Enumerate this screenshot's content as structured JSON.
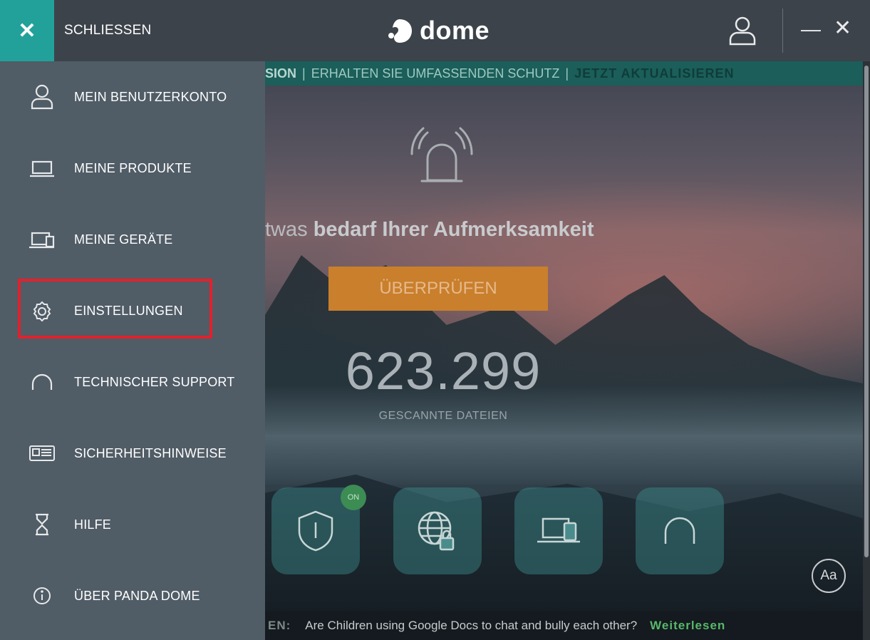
{
  "titlebar": {
    "close_label": "SCHLIESSEN",
    "logo_text": "dome"
  },
  "menu": {
    "items": [
      {
        "label": "MEIN BENUTZERKONTO",
        "icon": "user-icon"
      },
      {
        "label": "MEINE PRODUKTE",
        "icon": "laptop-icon"
      },
      {
        "label": "MEINE GERÄTE",
        "icon": "devices-icon"
      },
      {
        "label": "EINSTELLUNGEN",
        "icon": "gear-icon"
      },
      {
        "label": "TECHNISCHER SUPPORT",
        "icon": "headset-icon"
      },
      {
        "label": "SICHERHEITSHINWEISE",
        "icon": "news-icon"
      },
      {
        "label": "HILFE",
        "icon": "hourglass-icon"
      },
      {
        "label": "ÜBER PANDA DOME",
        "icon": "info-icon"
      }
    ]
  },
  "promo": {
    "part1": "SION",
    "part2": "ERHALTEN SIE UMFASSENDEN SCHUTZ",
    "cta": "JETZT AKTUALISIEREN"
  },
  "main": {
    "alert_prefix": "twas",
    "alert_bold": "bedarf Ihrer Aufmerksamkeit",
    "check_button": "ÜBERPRÜFEN",
    "scanned_count": "623.299",
    "scanned_label": "GESCANNTE DATEIEN",
    "on_badge": "ON",
    "aa_label": "Aa"
  },
  "news": {
    "label": "EN:",
    "headline": "Are Children using Google Docs to chat and bully each other?",
    "more": "Weiterlesen"
  },
  "colors": {
    "accent_teal": "#21a19a",
    "menu_bg": "#505c66",
    "highlight_red": "#e1212b",
    "button_orange": "#c97f2c"
  }
}
